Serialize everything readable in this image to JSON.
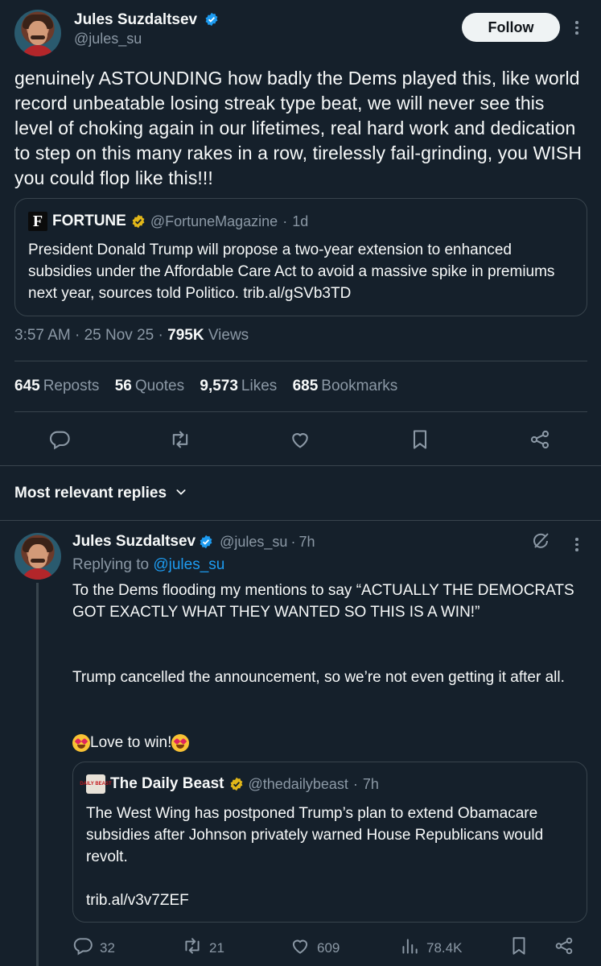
{
  "tweet": {
    "author_name": "Jules Suzdaltsev",
    "author_handle": "@jules_su",
    "follow_label": "Follow",
    "text": "genuinely ASTOUNDING how badly the Dems played this, like world record unbeatable losing streak type beat, we will never see this level of choking again in our lifetimes, real hard work and dedication to step on this many rakes in a row, tirelessly fail-grinding, you WISH you could flop like this!!!",
    "quote": {
      "logo_letter": "F",
      "name": "FORTUNE",
      "handle": "@FortuneMagazine",
      "sep": "·",
      "age": "1d",
      "text": "President Donald Trump will propose a two-year extension to enhanced subsidies under the Affordable Care Act to avoid a massive spike in premiums next year, sources told Politico. trib.al/gSVb3TD"
    },
    "time": "3:57 AM",
    "date": "25 Nov 25",
    "views_count": "795K",
    "views_label": "Views",
    "stats": {
      "reposts_count": "645",
      "reposts_label": "Reposts",
      "quotes_count": "56",
      "quotes_label": "Quotes",
      "likes_count": "9,573",
      "likes_label": "Likes",
      "bookmarks_count": "685",
      "bookmarks_label": "Bookmarks"
    }
  },
  "replies_header": "Most relevant replies",
  "reply": {
    "author_name": "Jules Suzdaltsev",
    "author_handle": "@jules_su",
    "age": "7h",
    "replying_to_label": "Replying to",
    "replying_to_handle": "@jules_su",
    "paragraph1": "To the Dems flooding my mentions to say “ACTUALLY THE DEMOCRATS GOT EXACTLY WHAT THEY WANTED SO THIS IS A WIN!”",
    "paragraph2": "Trump cancelled the announcement, so we’re not even getting it after all.",
    "paragraph3": "Love to win!",
    "quote": {
      "logo_text": "DAILY BEAST",
      "name": "The Daily Beast",
      "handle": "@thedailybeast",
      "age": "7h",
      "text": "The West Wing has postponed Trump’s plan to extend Obamacare subsidies after Johnson privately warned House Republicans would revolt.",
      "link": "trib.al/v3v7ZEF"
    },
    "actions": {
      "replies": "32",
      "reposts": "21",
      "likes": "609",
      "views": "78.4K"
    }
  },
  "colors": {
    "background": "#15202b",
    "accent": "#1d9bf0",
    "muted": "#8b98a5",
    "border": "#38444d"
  }
}
